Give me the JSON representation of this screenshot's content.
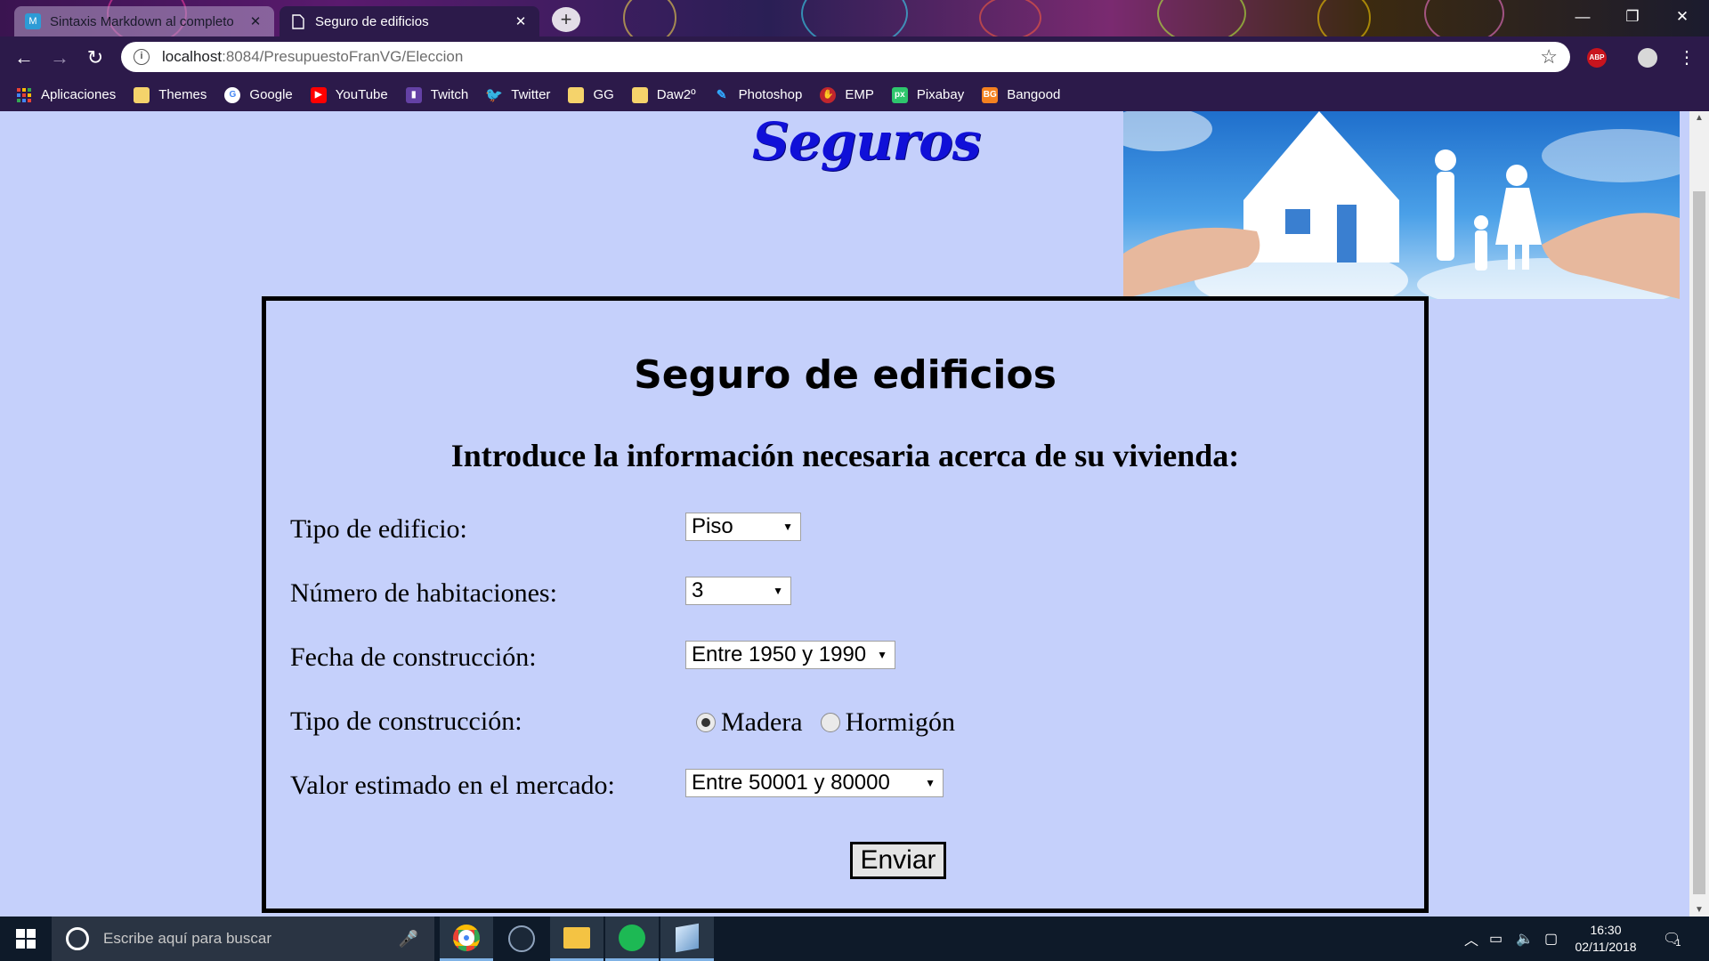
{
  "browser": {
    "tabs": [
      {
        "title": "Sintaxis Markdown al completo",
        "active": false,
        "favicon": "M"
      },
      {
        "title": "Seguro de edificios",
        "active": true,
        "favicon": "page"
      }
    ],
    "url_host": "localhost",
    "url_path": ":8084/PresupuestoFranVG/Eleccion",
    "extensions": [
      "ABP"
    ],
    "bookmarks": [
      {
        "label": "Aplicaciones",
        "icon": "apps-grid-icon",
        "color": "#e94235"
      },
      {
        "label": "Themes",
        "icon": "folder-icon",
        "color": "#f5d36b"
      },
      {
        "label": "Google",
        "icon": "google-icon",
        "color": "#ffffff"
      },
      {
        "label": "YouTube",
        "icon": "youtube-icon",
        "color": "#ff0000"
      },
      {
        "label": "Twitch",
        "icon": "twitch-icon",
        "color": "#6441a5"
      },
      {
        "label": "Twitter",
        "icon": "twitter-icon",
        "color": "#1da1f2"
      },
      {
        "label": "GG",
        "icon": "folder-icon",
        "color": "#f5d36b"
      },
      {
        "label": "Daw2º",
        "icon": "folder-icon",
        "color": "#f5d36b"
      },
      {
        "label": "Photoshop",
        "icon": "photoshop-icon",
        "color": "#31a8ff"
      },
      {
        "label": "EMP",
        "icon": "emp-icon",
        "color": "#c0262d"
      },
      {
        "label": "Pixabay",
        "icon": "pixabay-icon",
        "color": "#2ec66d"
      },
      {
        "label": "Bangood",
        "icon": "banggood-icon",
        "color": "#f58220"
      }
    ]
  },
  "page": {
    "site_title": "Seguros",
    "panel_title": "Seguro de edificios",
    "subtitle": "Introduce la información necesaria acerca de su vivienda:",
    "fields": {
      "building_type": {
        "label": "Tipo de edificio:",
        "value": "Piso"
      },
      "rooms": {
        "label": "Número de habitaciones:",
        "value": "3"
      },
      "build_date": {
        "label": "Fecha de construcción:",
        "value": "Entre 1950 y 1990"
      },
      "construction_type": {
        "label": "Tipo de construcción:",
        "options": [
          "Madera",
          "Hormigón"
        ],
        "selected": "Madera"
      },
      "market_value": {
        "label": "Valor estimado en el mercado:",
        "value": "Entre 50001 y 80000"
      }
    },
    "submit_label": "Enviar"
  },
  "taskbar": {
    "search_placeholder": "Escribe aquí para buscar",
    "time": "16:30",
    "date": "02/11/2018",
    "notifications": "1",
    "apps": [
      {
        "name": "chrome",
        "active": true,
        "color": "#e8453c"
      },
      {
        "name": "steam",
        "active": false,
        "color": "#1b2838"
      },
      {
        "name": "file-explorer",
        "active": true,
        "color": "#f4c343"
      },
      {
        "name": "spotify",
        "active": true,
        "color": "#1db954"
      },
      {
        "name": "virtualbox",
        "active": true,
        "color": "#9fc2e6"
      }
    ]
  }
}
